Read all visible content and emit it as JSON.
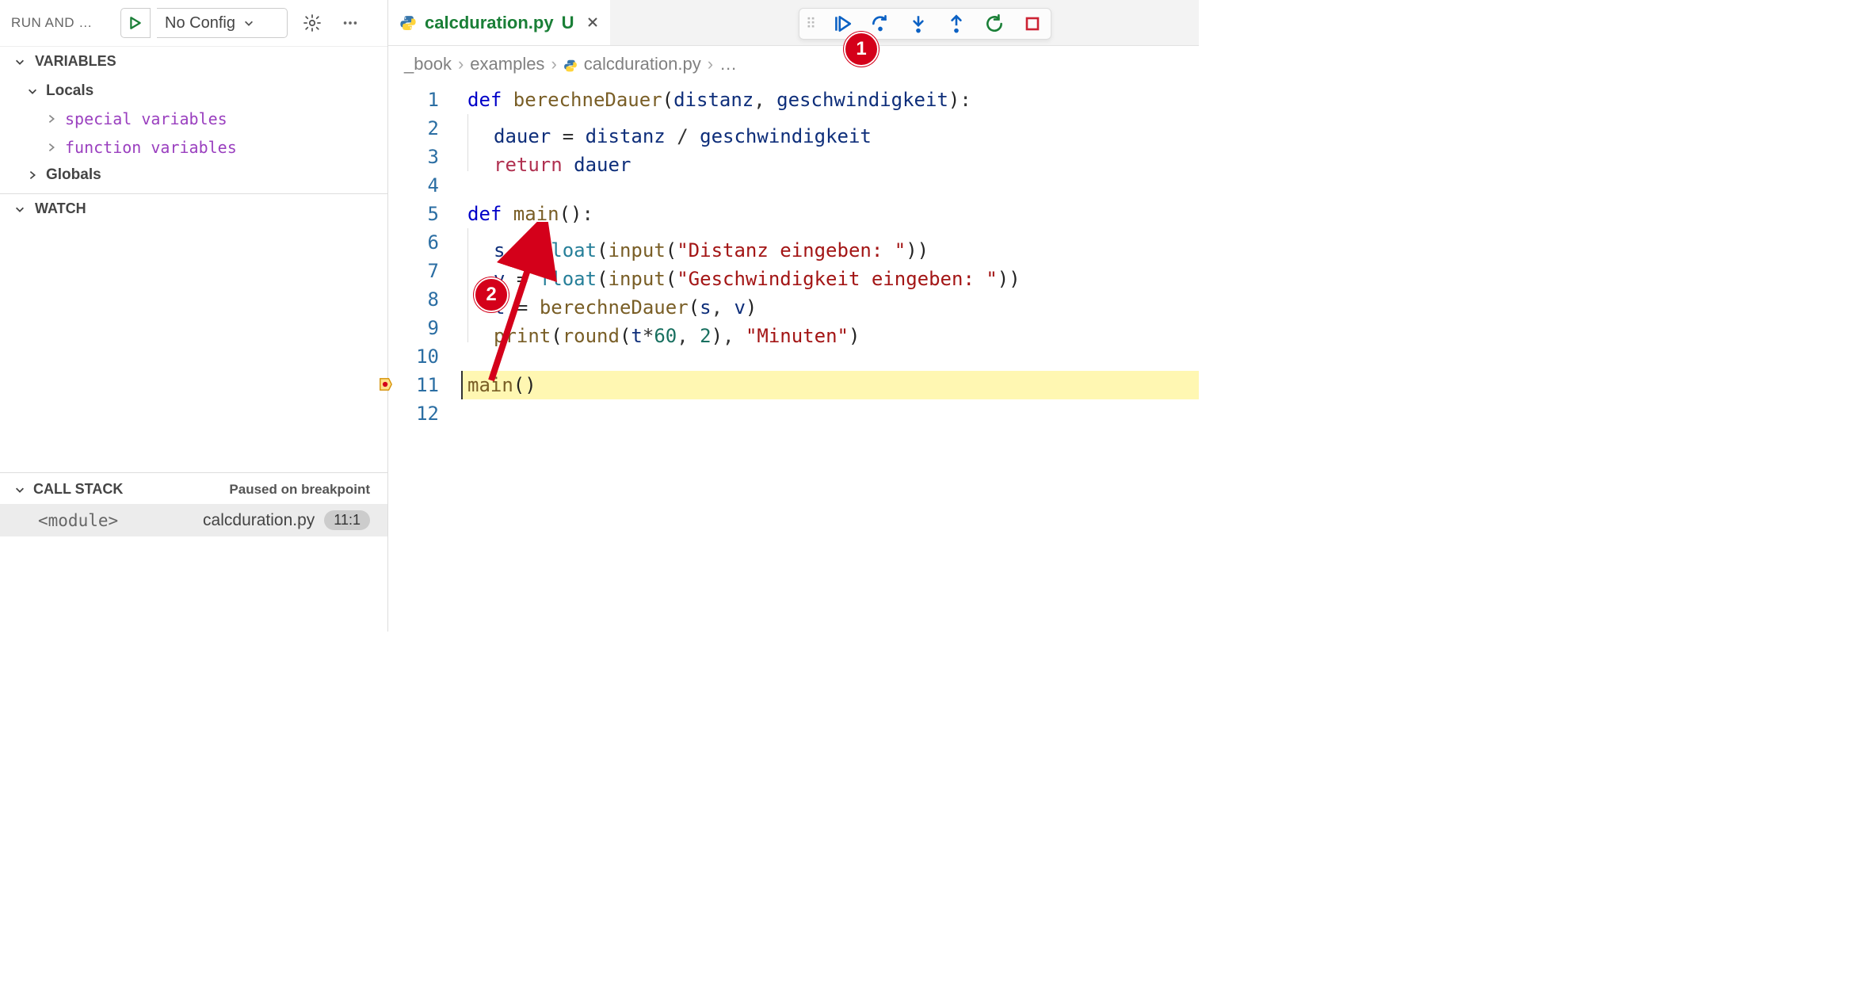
{
  "sidebar": {
    "title": "RUN AND …",
    "config_value": "No Config",
    "panels": {
      "variables": {
        "label": "VARIABLES",
        "locals_label": "Locals",
        "items": [
          "special variables",
          "function variables"
        ],
        "globals_label": "Globals"
      },
      "watch": {
        "label": "WATCH"
      },
      "callstack": {
        "label": "CALL STACK",
        "status": "Paused on breakpoint",
        "frames": [
          {
            "name": "<module>",
            "file": "calcduration.py",
            "pos": "11:1"
          }
        ]
      }
    }
  },
  "editor": {
    "tab": {
      "filename": "calcduration.py",
      "modified_marker": "U"
    },
    "breadcrumbs": [
      "_book",
      "examples",
      "calcduration.py",
      "…"
    ],
    "debug_toolbar": {
      "buttons": [
        "continue",
        "step-over",
        "step-into",
        "step-out",
        "restart",
        "stop"
      ]
    },
    "current_line": 11,
    "code_lines": [
      {
        "n": 1,
        "tokens": [
          {
            "t": "def ",
            "c": "kw"
          },
          {
            "t": "berechneDauer",
            "c": "fn"
          },
          {
            "t": "(",
            "c": "par"
          },
          {
            "t": "distanz",
            "c": "ident"
          },
          {
            "t": ", ",
            "c": "op"
          },
          {
            "t": "geschwindigkeit",
            "c": "ident"
          },
          {
            "t": ")",
            "c": "par"
          },
          {
            "t": ":",
            "c": "op"
          }
        ],
        "indent": 0
      },
      {
        "n": 2,
        "tokens": [
          {
            "t": "dauer",
            "c": "ident"
          },
          {
            "t": " = ",
            "c": "op"
          },
          {
            "t": "distanz",
            "c": "ident"
          },
          {
            "t": " / ",
            "c": "op"
          },
          {
            "t": "geschwindigkeit",
            "c": "ident"
          }
        ],
        "indent": 1
      },
      {
        "n": 3,
        "tokens": [
          {
            "t": "return ",
            "c": "ctl"
          },
          {
            "t": "dauer",
            "c": "ident"
          }
        ],
        "indent": 1
      },
      {
        "n": 4,
        "tokens": [],
        "indent": 0
      },
      {
        "n": 5,
        "tokens": [
          {
            "t": "def ",
            "c": "kw"
          },
          {
            "t": "main",
            "c": "fn"
          },
          {
            "t": "()",
            "c": "par"
          },
          {
            "t": ":",
            "c": "op"
          }
        ],
        "indent": 0
      },
      {
        "n": 6,
        "tokens": [
          {
            "t": "s",
            "c": "ident"
          },
          {
            "t": " = ",
            "c": "op"
          },
          {
            "t": "float",
            "c": "fn2"
          },
          {
            "t": "(",
            "c": "par"
          },
          {
            "t": "input",
            "c": "fn"
          },
          {
            "t": "(",
            "c": "par"
          },
          {
            "t": "\"Distanz eingeben: \"",
            "c": "str"
          },
          {
            "t": "))",
            "c": "par"
          }
        ],
        "indent": 1
      },
      {
        "n": 7,
        "tokens": [
          {
            "t": "v",
            "c": "ident"
          },
          {
            "t": " = ",
            "c": "op"
          },
          {
            "t": "float",
            "c": "fn2"
          },
          {
            "t": "(",
            "c": "par"
          },
          {
            "t": "input",
            "c": "fn"
          },
          {
            "t": "(",
            "c": "par"
          },
          {
            "t": "\"Geschwindigkeit eingeben: \"",
            "c": "str"
          },
          {
            "t": "))",
            "c": "par"
          }
        ],
        "indent": 1
      },
      {
        "n": 8,
        "tokens": [
          {
            "t": "t",
            "c": "ident"
          },
          {
            "t": " = ",
            "c": "op"
          },
          {
            "t": "berechneDauer",
            "c": "fn"
          },
          {
            "t": "(",
            "c": "par"
          },
          {
            "t": "s",
            "c": "ident"
          },
          {
            "t": ", ",
            "c": "op"
          },
          {
            "t": "v",
            "c": "ident"
          },
          {
            "t": ")",
            "c": "par"
          }
        ],
        "indent": 1
      },
      {
        "n": 9,
        "tokens": [
          {
            "t": "print",
            "c": "fn"
          },
          {
            "t": "(",
            "c": "par"
          },
          {
            "t": "round",
            "c": "fn"
          },
          {
            "t": "(",
            "c": "par"
          },
          {
            "t": "t",
            "c": "ident"
          },
          {
            "t": "*",
            "c": "op"
          },
          {
            "t": "60",
            "c": "num"
          },
          {
            "t": ", ",
            "c": "op"
          },
          {
            "t": "2",
            "c": "num"
          },
          {
            "t": ")",
            "c": "par"
          },
          {
            "t": ", ",
            "c": "op"
          },
          {
            "t": "\"Minuten\"",
            "c": "str"
          },
          {
            "t": ")",
            "c": "par"
          }
        ],
        "indent": 1
      },
      {
        "n": 10,
        "tokens": [],
        "indent": 0
      },
      {
        "n": 11,
        "tokens": [
          {
            "t": "main",
            "c": "fn"
          },
          {
            "t": "()",
            "c": "par"
          }
        ],
        "indent": 0
      },
      {
        "n": 12,
        "tokens": [],
        "indent": 0
      }
    ]
  },
  "annotations": {
    "badge1": "1",
    "badge2": "2"
  }
}
